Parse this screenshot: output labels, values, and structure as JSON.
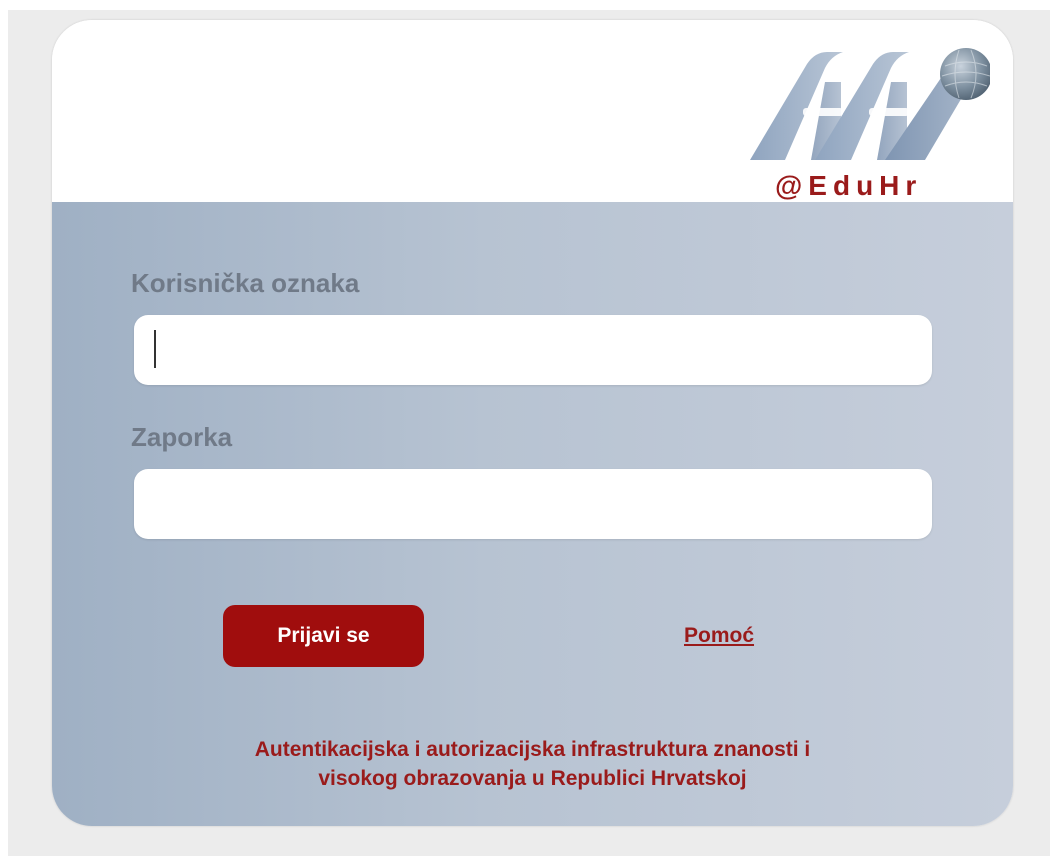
{
  "header": {
    "logo_text": "@EduHr",
    "logo_icon": "aai-logo-icon"
  },
  "form": {
    "username_label": "Korisnička oznaka",
    "username_value": "",
    "password_label": "Zaporka",
    "password_value": "",
    "login_button": "Prijavi se",
    "help_link": "Pomoć"
  },
  "footer": {
    "line1": "Autentikacijska i autorizacijska infrastruktura znanosti i",
    "line2": "visokog obrazovanja u Republici Hrvatskoj"
  },
  "colors": {
    "brand_red": "#a00d0d",
    "label_gray": "#707a88",
    "body_gradient_start": "#9fb0c4",
    "body_gradient_end": "#c6cedb"
  }
}
